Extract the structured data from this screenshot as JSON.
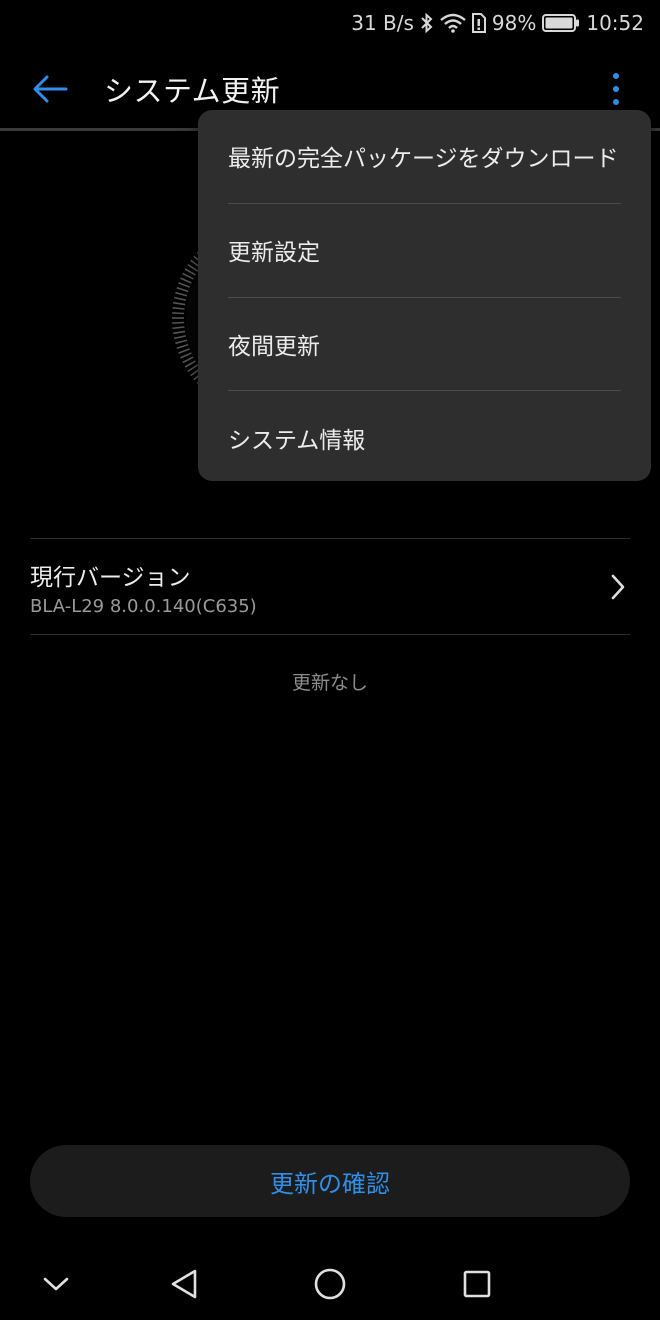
{
  "status_bar": {
    "net_speed": "31 B/s",
    "battery_percent": "98%",
    "time": "10:52",
    "icons": [
      "bluetooth-icon",
      "wifi-icon",
      "sim-icon",
      "battery-icon"
    ]
  },
  "app_bar": {
    "title": "システム更新"
  },
  "menu": {
    "items": [
      {
        "label": "最新の完全パッケージをダウンロード"
      },
      {
        "label": "更新設定"
      },
      {
        "label": "夜間更新"
      },
      {
        "label": "システム情報"
      }
    ]
  },
  "version": {
    "label": "現行バージョン",
    "value": "BLA-L29 8.0.0.140(C635)"
  },
  "status_text": "更新なし",
  "check_button": {
    "label": "更新の確認"
  },
  "colors": {
    "accent": "#2f8fe8",
    "background": "#000000",
    "menu_bg": "#2e2e2e"
  }
}
